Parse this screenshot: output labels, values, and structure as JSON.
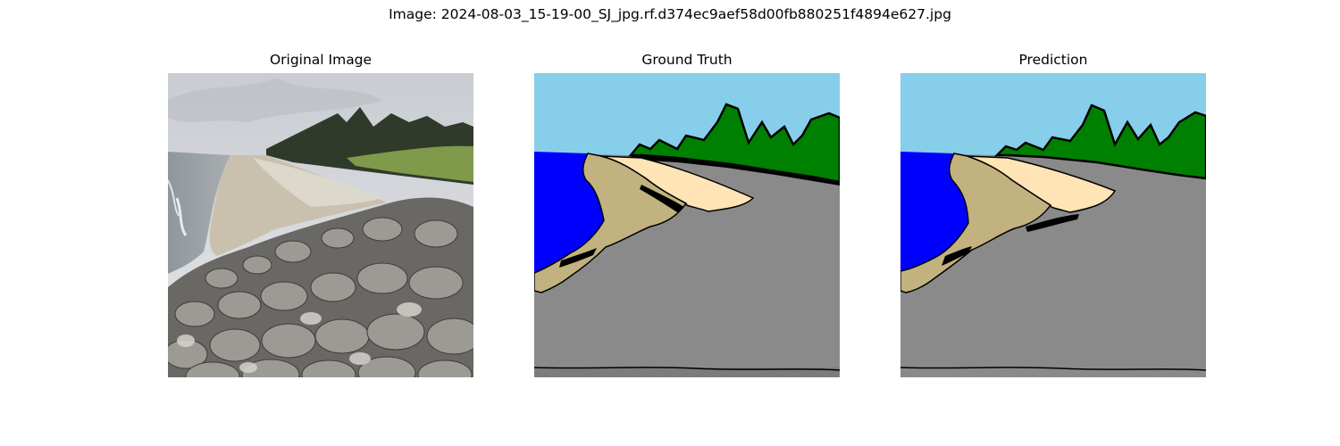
{
  "figure": {
    "suptitle": "Image: 2024-08-03_15-19-00_SJ_jpg.rf.d374ec9aef58d00fb880251f4894e627.jpg"
  },
  "panels": [
    {
      "title": "Original Image"
    },
    {
      "title": "Ground Truth"
    },
    {
      "title": "Prediction"
    }
  ],
  "colors": {
    "sky": "#87CEEB",
    "vegetation": "#008000",
    "water": "#0000FF",
    "wet_sand": "#C2B280",
    "dry_sand": "#FFE4B5",
    "rocks": "#8A8A8A",
    "boundary": "#000000"
  }
}
